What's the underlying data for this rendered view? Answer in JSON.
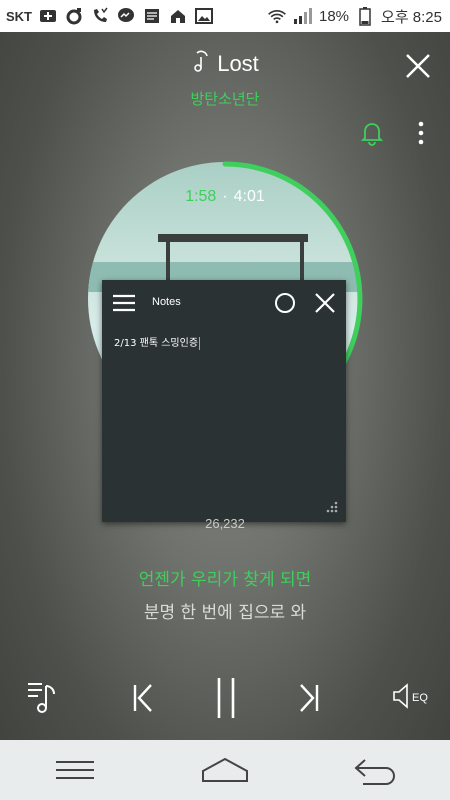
{
  "status_bar": {
    "carrier": "SKT",
    "battery": "18%",
    "time": "오후 8:25",
    "icons": [
      "usb-icon",
      "sync-icon",
      "missed-call-icon",
      "messenger-icon",
      "news-icon",
      "home-icon",
      "image-icon",
      "wifi-icon",
      "signal-icon",
      "battery-icon"
    ]
  },
  "player": {
    "song_title": "Lost",
    "artist": "방탄소년단",
    "time_current": "1:58",
    "time_separator": "·",
    "time_total": "4:01",
    "progress_fraction": 0.49,
    "likes": "26,232",
    "lyric_current": "언젠가 우리가 찾게 되면",
    "lyric_next": "분명 한 번에 집으로 와"
  },
  "notes": {
    "title": "Notes",
    "text": "2/13 팬톡 스밍인증"
  },
  "controls": {
    "eq_label": "EQ"
  },
  "colors": {
    "accent": "#3ecf5d",
    "notes_bg": "#2b3234",
    "nav_bg": "#e8ecec"
  }
}
